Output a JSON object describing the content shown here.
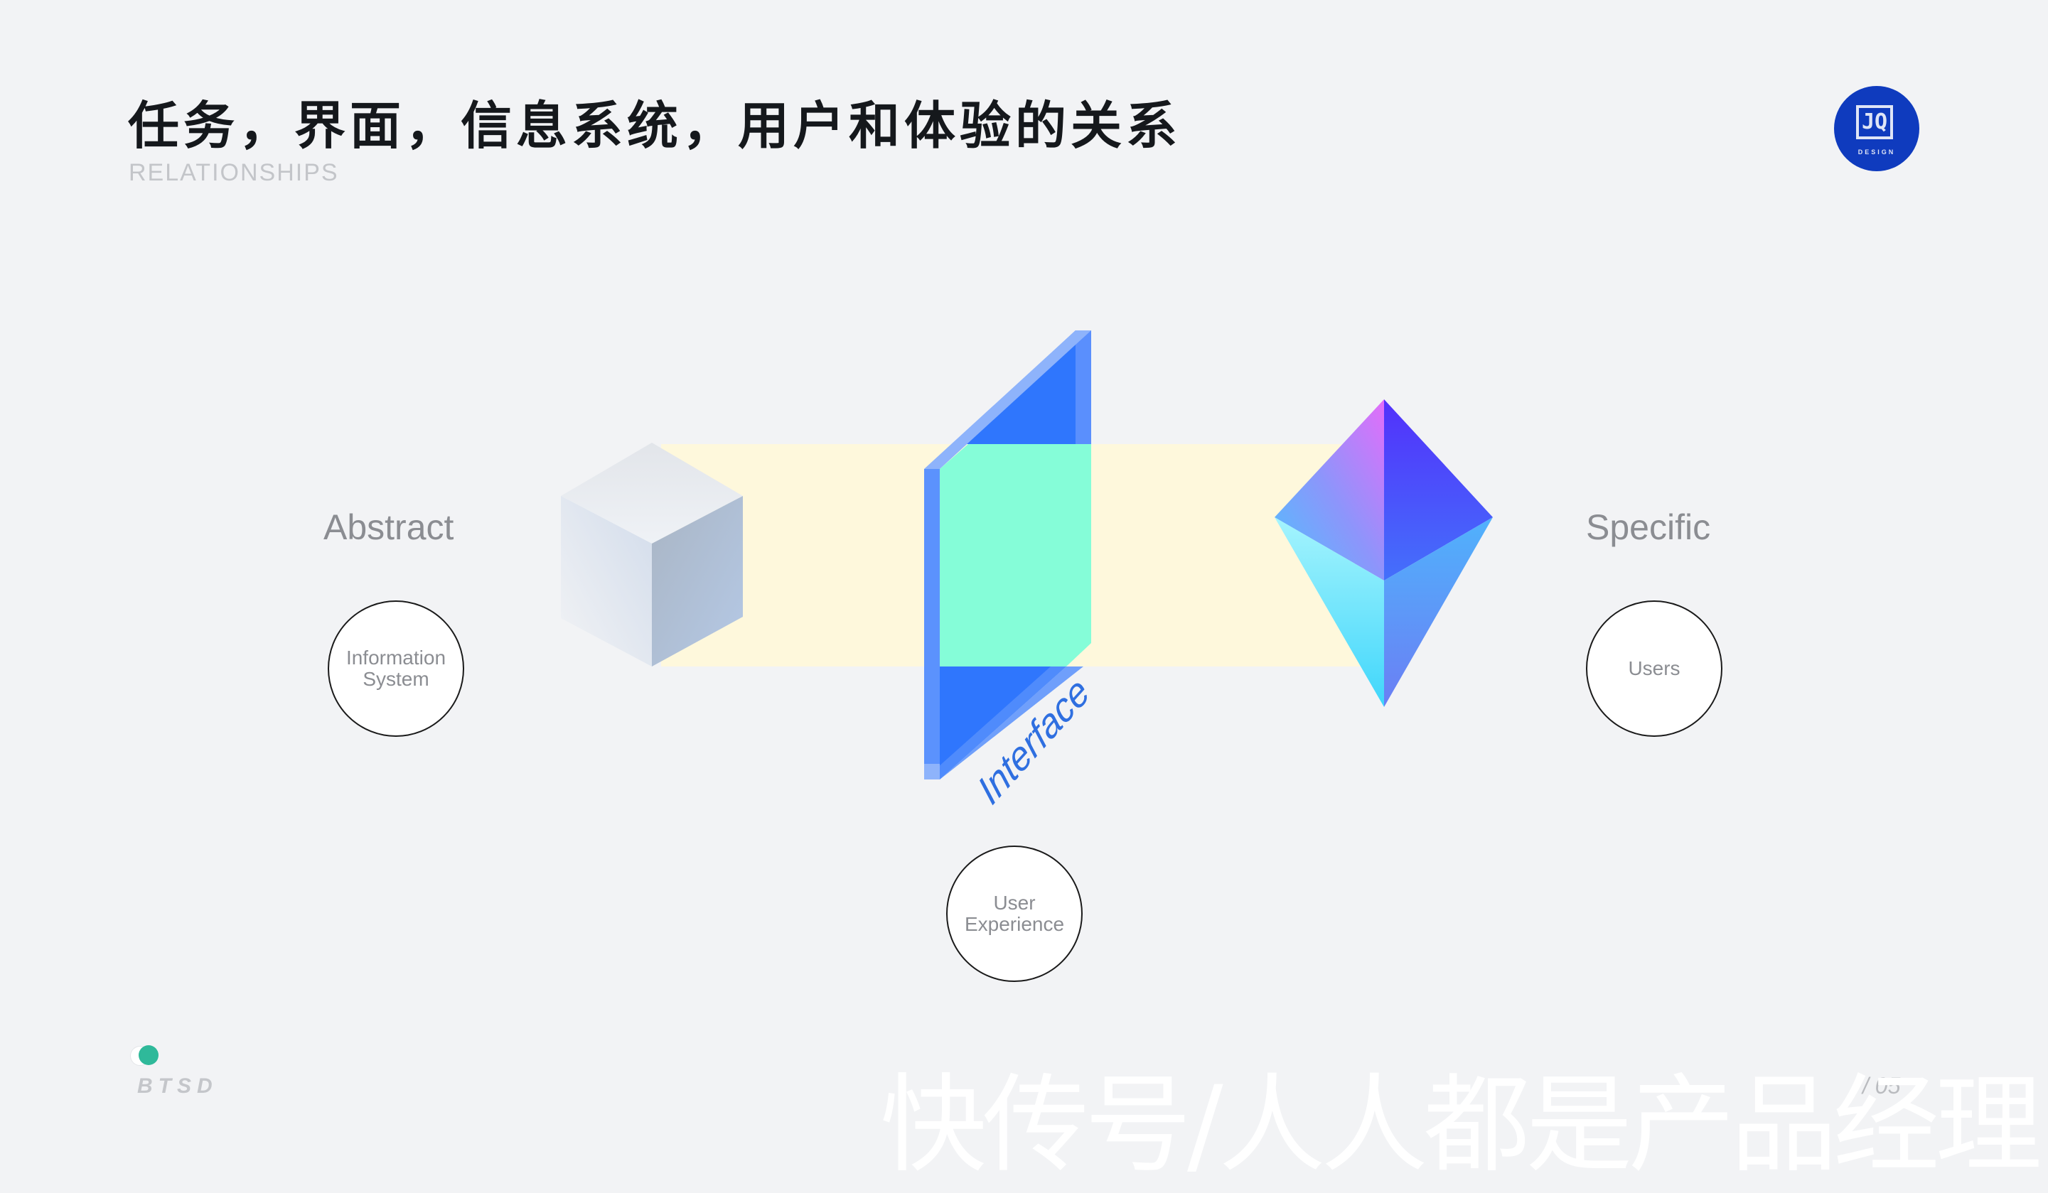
{
  "header": {
    "title": "任务，界面，信息系统，用户和体验的关系",
    "subtitle": "RELATIONSHIPS"
  },
  "logo": {
    "mark": "JQ",
    "text": "DESIGN",
    "color": "#0f3bbe"
  },
  "diagram": {
    "left_label": "Abstract",
    "right_label": "Specific",
    "interface_label": "Interface",
    "nodes": {
      "information_system": [
        "Information",
        "System"
      ],
      "users": [
        "Users"
      ],
      "user_experience": [
        "User",
        "Experience"
      ]
    },
    "colors": {
      "band": "#fef8dc",
      "interface_face": "#85fdd8",
      "interface_blue": "#2f76fd",
      "interface_edge": "#5b92fd",
      "interface_text": "#2f6fe0"
    }
  },
  "footer": {
    "brand": "BTSD",
    "page": "/ 05",
    "watermark": "快传号/人人都是产品经理"
  }
}
